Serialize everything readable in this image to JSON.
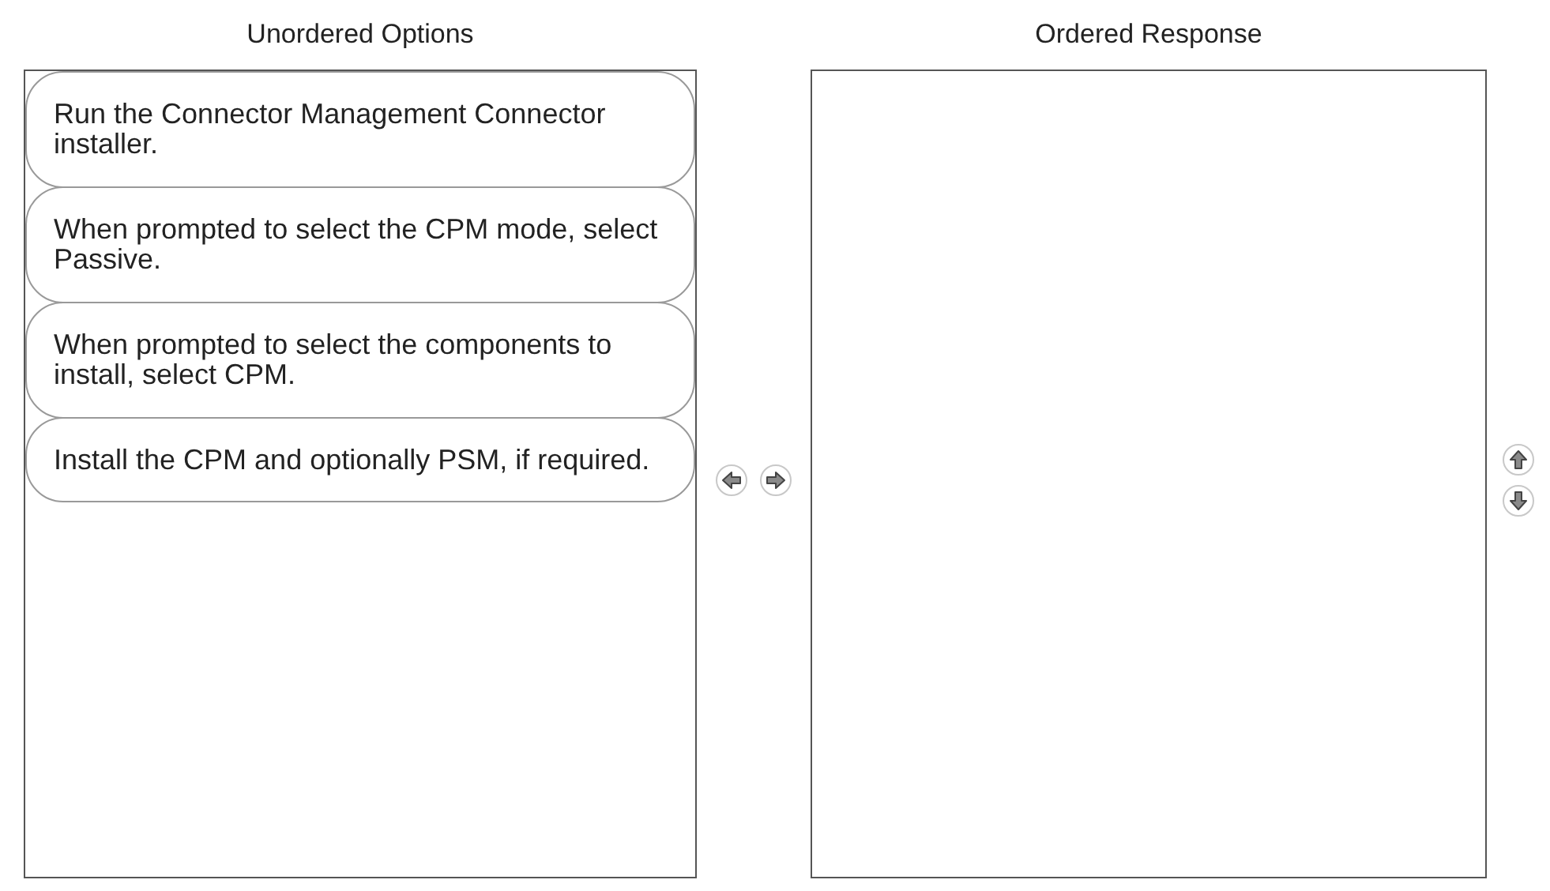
{
  "unordered_options": {
    "title": "Unordered Options",
    "items": [
      {
        "text": "Run the Connector Management Connector installer."
      },
      {
        "text": "When prompted to select the CPM mode, select Passive."
      },
      {
        "text": "When prompted to select the components to install, select CPM."
      },
      {
        "text": "Install the CPM and optionally PSM, if required."
      }
    ]
  },
  "ordered_response": {
    "title": "Ordered Response"
  }
}
